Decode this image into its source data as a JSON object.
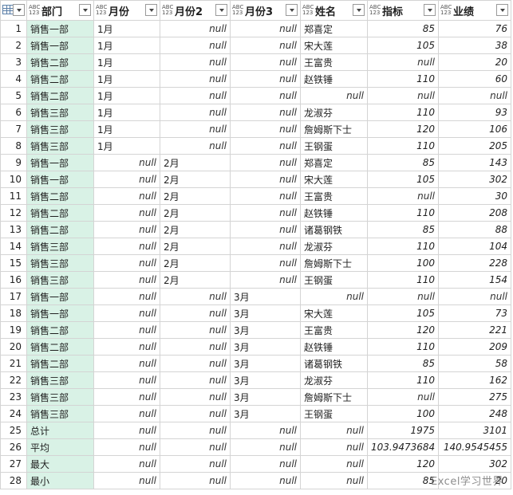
{
  "type_icon_text": "ABC\n123",
  "columns": [
    "部门",
    "月份",
    "月份2",
    "月份3",
    "姓名",
    "指标",
    "业绩"
  ],
  "rows": [
    [
      "1",
      "销售一部",
      "1月",
      "null",
      "null",
      "郑喜定",
      "85",
      "76"
    ],
    [
      "2",
      "销售一部",
      "1月",
      "null",
      "null",
      "宋大莲",
      "105",
      "38"
    ],
    [
      "3",
      "销售二部",
      "1月",
      "null",
      "null",
      "王富贵",
      "null",
      "20"
    ],
    [
      "4",
      "销售二部",
      "1月",
      "null",
      "null",
      "赵铁锤",
      "110",
      "60"
    ],
    [
      "5",
      "销售二部",
      "1月",
      "null",
      "null",
      "null",
      "null",
      "null"
    ],
    [
      "6",
      "销售三部",
      "1月",
      "null",
      "null",
      "龙淑芬",
      "110",
      "93"
    ],
    [
      "7",
      "销售三部",
      "1月",
      "null",
      "null",
      "詹姆斯下士",
      "120",
      "106"
    ],
    [
      "8",
      "销售三部",
      "1月",
      "null",
      "null",
      "王钢蛋",
      "110",
      "205"
    ],
    [
      "9",
      "销售一部",
      "null",
      "2月",
      "null",
      "郑喜定",
      "85",
      "143"
    ],
    [
      "10",
      "销售一部",
      "null",
      "2月",
      "null",
      "宋大莲",
      "105",
      "302"
    ],
    [
      "11",
      "销售二部",
      "null",
      "2月",
      "null",
      "王富贵",
      "null",
      "30"
    ],
    [
      "12",
      "销售二部",
      "null",
      "2月",
      "null",
      "赵铁锤",
      "110",
      "208"
    ],
    [
      "13",
      "销售二部",
      "null",
      "2月",
      "null",
      "诸葛钢铁",
      "85",
      "88"
    ],
    [
      "14",
      "销售三部",
      "null",
      "2月",
      "null",
      "龙淑芬",
      "110",
      "104"
    ],
    [
      "15",
      "销售三部",
      "null",
      "2月",
      "null",
      "詹姆斯下士",
      "100",
      "228"
    ],
    [
      "16",
      "销售三部",
      "null",
      "2月",
      "null",
      "王钢蛋",
      "110",
      "154"
    ],
    [
      "17",
      "销售一部",
      "null",
      "null",
      "3月",
      "null",
      "null",
      "null"
    ],
    [
      "18",
      "销售一部",
      "null",
      "null",
      "3月",
      "宋大莲",
      "105",
      "73"
    ],
    [
      "19",
      "销售二部",
      "null",
      "null",
      "3月",
      "王富贵",
      "120",
      "221"
    ],
    [
      "20",
      "销售二部",
      "null",
      "null",
      "3月",
      "赵铁锤",
      "110",
      "209"
    ],
    [
      "21",
      "销售二部",
      "null",
      "null",
      "3月",
      "诸葛钢铁",
      "85",
      "58"
    ],
    [
      "22",
      "销售三部",
      "null",
      "null",
      "3月",
      "龙淑芬",
      "110",
      "162"
    ],
    [
      "23",
      "销售三部",
      "null",
      "null",
      "3月",
      "詹姆斯下士",
      "null",
      "275"
    ],
    [
      "24",
      "销售三部",
      "null",
      "null",
      "3月",
      "王钢蛋",
      "100",
      "248"
    ],
    [
      "25",
      "总计",
      "null",
      "null",
      "null",
      "null",
      "1975",
      "3101"
    ],
    [
      "26",
      "平均",
      "null",
      "null",
      "null",
      "null",
      "103.9473684",
      "140.9545455"
    ],
    [
      "27",
      "最大",
      "null",
      "null",
      "null",
      "null",
      "120",
      "302"
    ],
    [
      "28",
      "最小",
      "null",
      "null",
      "null",
      "null",
      "85",
      "20"
    ]
  ],
  "watermark": "Excel学习世界",
  "colors": {
    "dept_highlight": "#d9f2e6",
    "grid_line": "#d4d4d4"
  }
}
